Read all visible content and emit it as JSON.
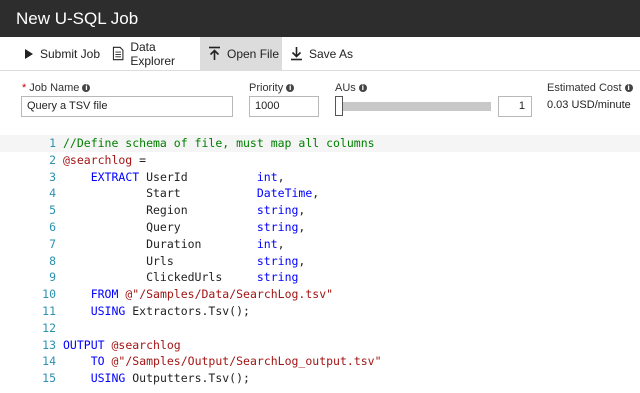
{
  "window": {
    "title": "New U-SQL Job"
  },
  "toolbar": {
    "submit": "Submit Job",
    "explorer": "Data Explorer",
    "open": "Open File",
    "save": "Save As"
  },
  "form": {
    "job_name_label": "Job Name",
    "job_name_value": "Query a TSV file",
    "priority_label": "Priority",
    "priority_value": "1000",
    "aus_label": "AUs",
    "aus_value": "1",
    "aus_slider_fraction": 0.0,
    "cost_label": "Estimated Cost",
    "cost_value": "0.03 USD/minute"
  },
  "editor": {
    "lines": [
      {
        "n": "1",
        "tokens": [
          {
            "t": "//Define schema of file, must map all columns",
            "c": "c"
          }
        ]
      },
      {
        "n": "2",
        "tokens": [
          {
            "t": "@searchlog",
            "c": "s"
          },
          {
            "t": " =",
            "c": "p"
          }
        ]
      },
      {
        "n": "3",
        "tokens": [
          {
            "t": "    ",
            "c": "p"
          },
          {
            "t": "EXTRACT",
            "c": "k"
          },
          {
            "t": " UserId          ",
            "c": "p"
          },
          {
            "t": "int",
            "c": "t"
          },
          {
            "t": ",",
            "c": "p"
          }
        ]
      },
      {
        "n": "4",
        "tokens": [
          {
            "t": "            Start           ",
            "c": "p"
          },
          {
            "t": "DateTime",
            "c": "t"
          },
          {
            "t": ",",
            "c": "p"
          }
        ]
      },
      {
        "n": "5",
        "tokens": [
          {
            "t": "            Region          ",
            "c": "p"
          },
          {
            "t": "string",
            "c": "t"
          },
          {
            "t": ",",
            "c": "p"
          }
        ]
      },
      {
        "n": "6",
        "tokens": [
          {
            "t": "            Query           ",
            "c": "p"
          },
          {
            "t": "string",
            "c": "t"
          },
          {
            "t": ",",
            "c": "p"
          }
        ]
      },
      {
        "n": "7",
        "tokens": [
          {
            "t": "            Duration        ",
            "c": "p"
          },
          {
            "t": "int",
            "c": "t"
          },
          {
            "t": ",",
            "c": "p"
          }
        ]
      },
      {
        "n": "8",
        "tokens": [
          {
            "t": "            Urls            ",
            "c": "p"
          },
          {
            "t": "string",
            "c": "t"
          },
          {
            "t": ",",
            "c": "p"
          }
        ]
      },
      {
        "n": "9",
        "tokens": [
          {
            "t": "            ClickedUrls     ",
            "c": "p"
          },
          {
            "t": "string",
            "c": "t"
          }
        ]
      },
      {
        "n": "10",
        "tokens": [
          {
            "t": "    ",
            "c": "p"
          },
          {
            "t": "FROM",
            "c": "k"
          },
          {
            "t": " ",
            "c": "p"
          },
          {
            "t": "@\"/Samples/Data/SearchLog.tsv\"",
            "c": "s"
          }
        ]
      },
      {
        "n": "11",
        "tokens": [
          {
            "t": "    ",
            "c": "p"
          },
          {
            "t": "USING",
            "c": "k"
          },
          {
            "t": " Extractors.Tsv();",
            "c": "p"
          }
        ]
      },
      {
        "n": "12",
        "tokens": [
          {
            "t": "",
            "c": "p"
          }
        ]
      },
      {
        "n": "13",
        "tokens": [
          {
            "t": "OUTPUT",
            "c": "k"
          },
          {
            "t": " ",
            "c": "p"
          },
          {
            "t": "@searchlog",
            "c": "s"
          }
        ]
      },
      {
        "n": "14",
        "tokens": [
          {
            "t": "    ",
            "c": "p"
          },
          {
            "t": "TO",
            "c": "k"
          },
          {
            "t": " ",
            "c": "p"
          },
          {
            "t": "@\"/Samples/Output/SearchLog_output.tsv\"",
            "c": "s"
          }
        ]
      },
      {
        "n": "15",
        "tokens": [
          {
            "t": "    ",
            "c": "p"
          },
          {
            "t": "USING",
            "c": "k"
          },
          {
            "t": " Outputters.Tsv();",
            "c": "p"
          }
        ]
      }
    ]
  }
}
